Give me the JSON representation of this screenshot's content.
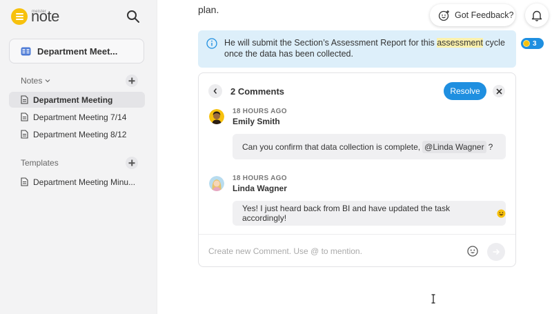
{
  "app": {
    "brand_small": "meister",
    "brand_name": "note"
  },
  "document": {
    "title": "Department Meet..."
  },
  "sidebar": {
    "notes_label": "Notes",
    "notes": [
      {
        "label": "Department Meeting",
        "active": true
      },
      {
        "label": "Department Meeting 7/14",
        "active": false
      },
      {
        "label": "Department Meeting 8/12",
        "active": false
      }
    ],
    "templates_label": "Templates",
    "templates": [
      {
        "label": "Department Meeting Minu..."
      }
    ]
  },
  "editor": {
    "top_text": "plan.",
    "banner": {
      "before": "He will submit the Section’s Assessment Report for this ",
      "highlight": "assessment",
      "after": " cycle once the data has been collected."
    },
    "comment_badge_count": "3"
  },
  "header": {
    "feedback_label": "Got Feedback?"
  },
  "comments_panel": {
    "title": "2 Comments",
    "resolve_label": "Resolve",
    "comments": [
      {
        "time": "18 HOURS AGO",
        "author": "Emily Smith",
        "text_before": "Can you confirm that data collection is complete,",
        "mention": "@Linda Wagner",
        "text_after": "?"
      },
      {
        "time": "18 HOURS AGO",
        "author": "Linda Wagner",
        "text": "Yes! I just heard back from BI and have updated the task accordingly!"
      }
    ],
    "input_placeholder": "Create new Comment. Use @ to mention."
  },
  "colors": {
    "accent": "#1f8fe0",
    "brand": "#f7c10d",
    "banner_bg": "#ddeffa",
    "highlight": "#fbf1ad"
  }
}
